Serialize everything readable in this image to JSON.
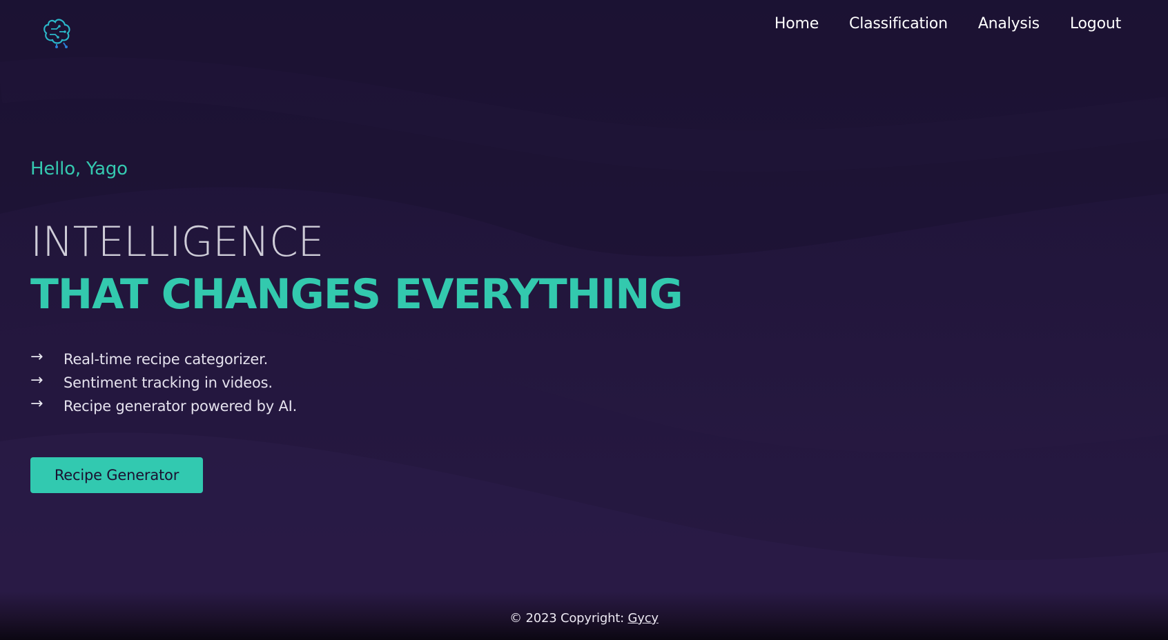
{
  "nav": {
    "logo_icon": "brain-circuit-icon",
    "items": [
      {
        "label": "Home"
      },
      {
        "label": "Classification"
      },
      {
        "label": "Analysis"
      },
      {
        "label": "Logout"
      }
    ]
  },
  "hero": {
    "greeting": "Hello, Yago",
    "headline_line1": "INTELLIGENCE",
    "headline_line2": "THAT CHANGES EVERYTHING",
    "features": [
      {
        "icon": "arrow-right-icon",
        "text": "Real-time recipe categorizer."
      },
      {
        "icon": "arrow-right-icon",
        "text": "Sentiment tracking in videos."
      },
      {
        "icon": "arrow-right-icon",
        "text": "Recipe generator powered by AI."
      }
    ],
    "cta_label": "Recipe Generator"
  },
  "footer": {
    "copyright": "© 2023 Copyright: ",
    "link_text": "Gycy"
  },
  "colors": {
    "background": "#1e1437",
    "accent": "#33c9ae",
    "headline_light": "#cfcdd8",
    "text": "#e8e6ef"
  }
}
